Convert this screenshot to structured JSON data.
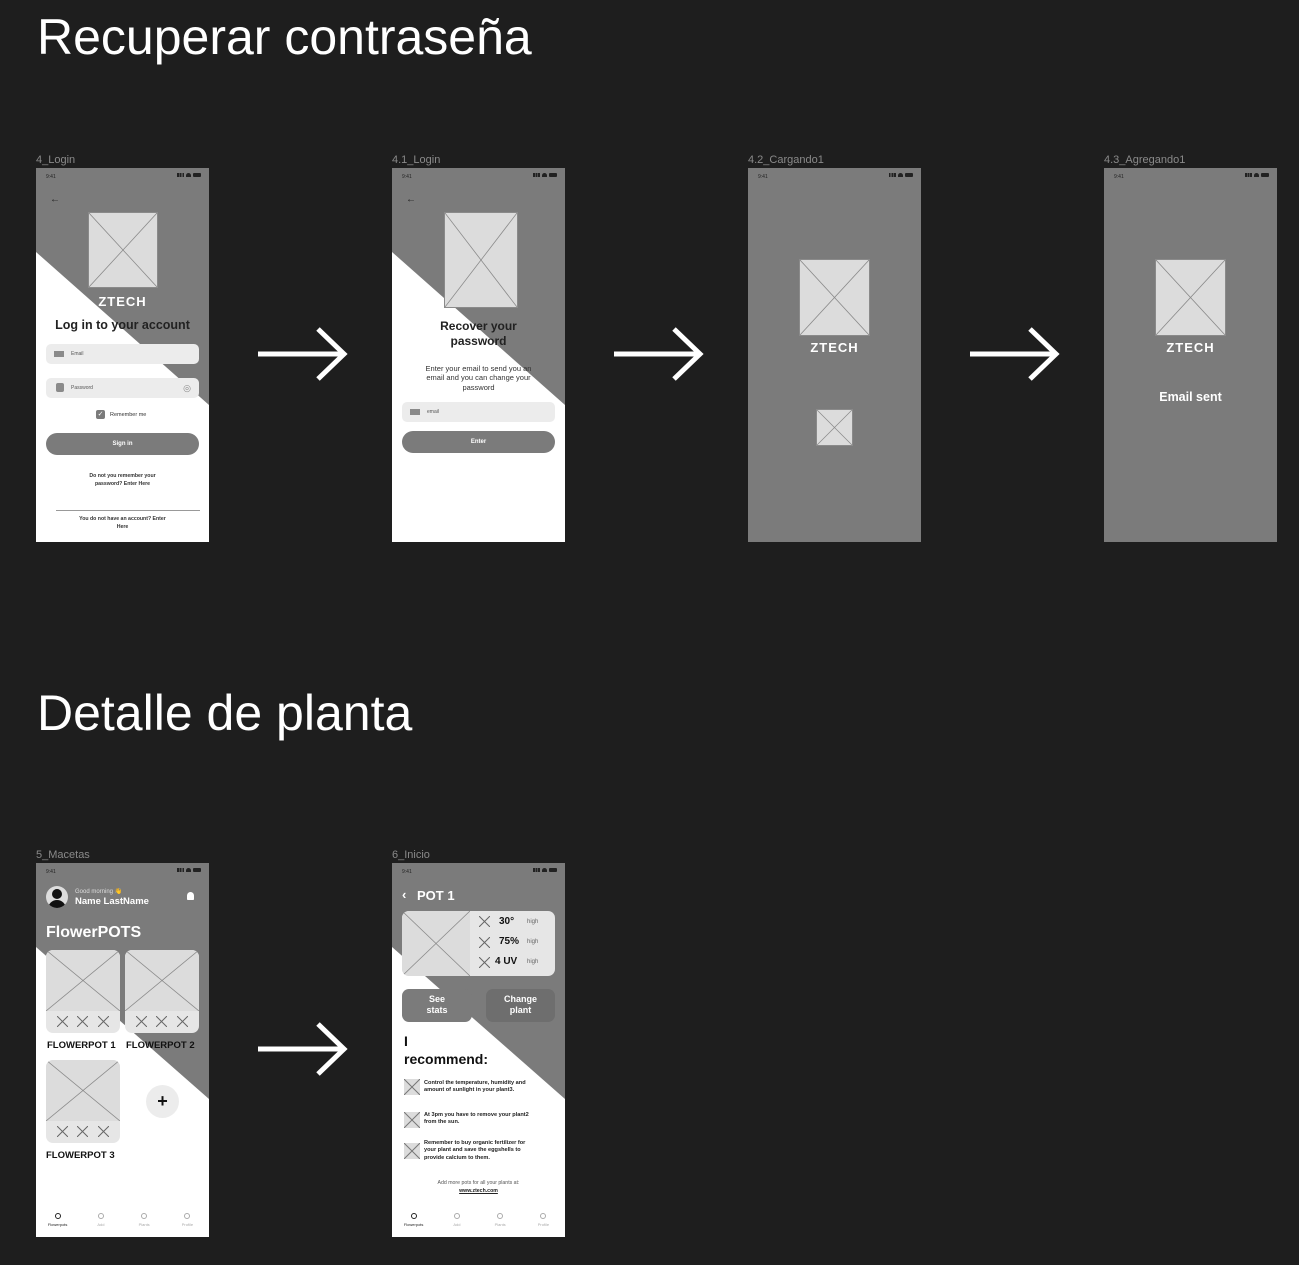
{
  "sections": {
    "recover": "Recuperar contraseña",
    "detail": "Detalle de planta"
  },
  "status_time": "9:41",
  "frames": {
    "login": {
      "label": "4_Login",
      "logo": "ZTECH",
      "title": "Log in to your account",
      "email_placeholder": "Email",
      "password_placeholder": "Password",
      "remember": "Remember me",
      "signin": "Sign in",
      "forgot_line1": "Do not you remember your",
      "forgot_line2": "password? Enter Here",
      "signup_line1": "You do not have an account? Enter",
      "signup_line2": "Here"
    },
    "recover": {
      "label": "4.1_Login",
      "title_line1": "Recover your",
      "title_line2": "password",
      "desc_line1": "Enter your email to send you an",
      "desc_line2": "email and you can change your",
      "desc_line3": "password",
      "email_placeholder": "email",
      "enter": "Enter"
    },
    "loading": {
      "label": "4.2_Cargando1",
      "logo": "ZTECH"
    },
    "sent": {
      "label": "4.3_Agregando1",
      "logo": "ZTECH",
      "message": "Email sent"
    },
    "pots": {
      "label": "5_Macetas",
      "greeting": "Good morning 👋",
      "name": "Name LastName",
      "title": "FlowerPOTS",
      "pots": [
        "FLOWERPOT 1",
        "FLOWERPOT 2",
        "FLOWERPOT 3"
      ],
      "add": "+"
    },
    "home": {
      "label": "6_Inicio",
      "title": "POT 1",
      "metrics": [
        {
          "value": "30°",
          "level": "high"
        },
        {
          "value": "75%",
          "level": "high"
        },
        {
          "value": "4 UV",
          "level": "high"
        }
      ],
      "see_stats_1": "See",
      "see_stats_2": "stats",
      "change_plant_1": "Change",
      "change_plant_2": "plant",
      "recommend_1": "I",
      "recommend_2": "recommend:",
      "recommendations": [
        [
          "Control the temperature, humidity and",
          "amount of sunlight in your plant3."
        ],
        [
          "At 3pm you have to remove your plant2",
          "from the sun."
        ],
        [
          "Remember to buy organic fertilizer for",
          "your plant and save the eggshells to",
          "provide calcium to them."
        ]
      ],
      "footer_1": "Add more pots for all your plants at:",
      "footer_2": "www.ztech.com"
    }
  },
  "nav": [
    "Flowerpots",
    "Add",
    "Plants",
    "Profile"
  ]
}
